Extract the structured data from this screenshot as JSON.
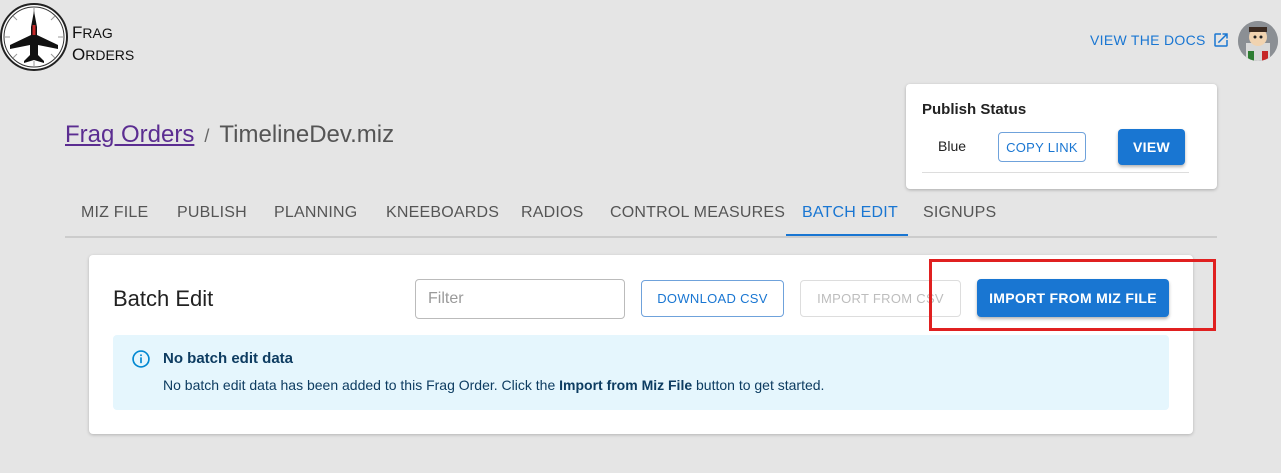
{
  "brand": {
    "line1_cap": "F",
    "line1_rest": "RAG",
    "line2_cap": "O",
    "line2_rest": "RDERS"
  },
  "header": {
    "docs_label": "VIEW THE DOCS",
    "docs_icon": "external-link-icon"
  },
  "breadcrumb": {
    "root": "Frag Orders",
    "separator": "/",
    "current": "TimelineDev.miz"
  },
  "publish": {
    "title": "Publish Status",
    "team": "Blue",
    "copy_link_label": "COPY LINK",
    "view_label": "VIEW"
  },
  "tabs": [
    {
      "label": "MIZ FILE"
    },
    {
      "label": "PUBLISH"
    },
    {
      "label": "PLANNING"
    },
    {
      "label": "KNEEBOARDS"
    },
    {
      "label": "RADIOS"
    },
    {
      "label": "CONTROL MEASURES"
    },
    {
      "label": "BATCH EDIT"
    },
    {
      "label": "SIGNUPS"
    }
  ],
  "active_tab": "BATCH EDIT",
  "batch_edit": {
    "title": "Batch Edit",
    "filter_placeholder": "Filter",
    "filter_value": "",
    "download_label": "DOWNLOAD CSV",
    "import_csv_label": "IMPORT FROM CSV",
    "import_miz_label": "IMPORT FROM MIZ FILE"
  },
  "alert": {
    "icon": "info-icon",
    "title": "No batch edit data",
    "body_prefix": "No batch edit data has been added to this Frag Order. Click the ",
    "body_bold": "Import from Miz File",
    "body_suffix": " button to get started."
  },
  "colors": {
    "accent": "#1976d2",
    "highlight": "#e02020",
    "alert_bg": "#e5f6fd",
    "link_visited": "#5b2d91"
  }
}
